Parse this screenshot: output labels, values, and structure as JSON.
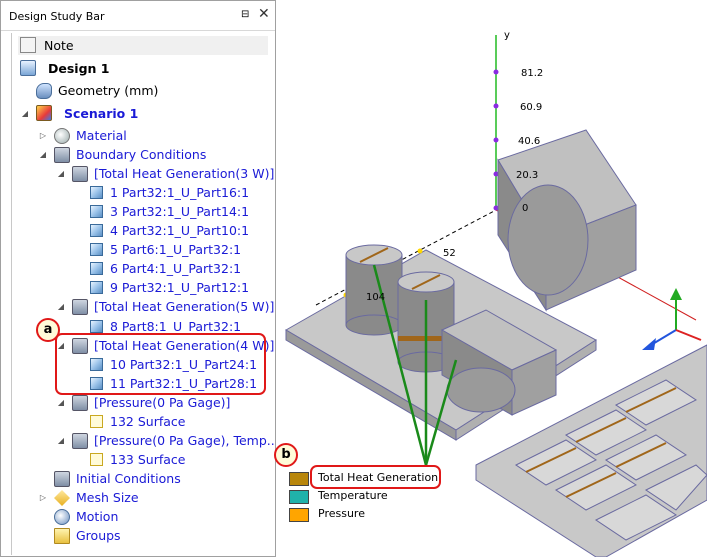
{
  "panel": {
    "title": "Design Study Bar",
    "pin_glyph": "⊟",
    "close_glyph": "✕"
  },
  "tree": {
    "note": "Note",
    "design": "Design 1",
    "geometry": "Geometry (mm)",
    "scenario": "Scenario 1",
    "material": "Material",
    "boundary_conditions": "Boundary Conditions",
    "heat_gen_3w": {
      "label": "[Total Heat Generation(3 W)]",
      "children": [
        "1 Part32:1_U_Part16:1",
        "3 Part32:1_U_Part14:1",
        "4 Part32:1_U_Part10:1",
        "5 Part6:1_U_Part32:1",
        "6 Part4:1_U_Part32:1",
        "9 Part32:1_U_Part12:1"
      ]
    },
    "heat_gen_5w": {
      "label": "[Total Heat Generation(5 W)]",
      "children": [
        "8 Part8:1_U_Part32:1"
      ]
    },
    "heat_gen_4w": {
      "label": "[Total Heat Generation(4 W)]",
      "children": [
        "10 Part32:1_U_Part24:1",
        "11 Part32:1_U_Part28:1"
      ]
    },
    "pressure_1": {
      "label": "[Pressure(0 Pa Gage)]",
      "children": [
        "132 Surface"
      ]
    },
    "pressure_2": {
      "label": "[Pressure(0 Pa Gage), Temp...",
      "children": [
        "133 Surface"
      ]
    },
    "initial_conditions": "Initial Conditions",
    "mesh_size": "Mesh Size",
    "motion": "Motion",
    "groups": "Groups"
  },
  "callouts": {
    "a": "a",
    "b": "b"
  },
  "viewport": {
    "axis_y_label": "y",
    "axis_ticks": [
      "81.2",
      "60.9",
      "40.6",
      "20.3",
      "0"
    ],
    "dim_52": "52",
    "dim_104": "104",
    "legend": [
      {
        "label": "Total Heat Generation",
        "color": "#b8860b"
      },
      {
        "label": "Temperature",
        "color": "#20b2aa"
      },
      {
        "label": "Pressure",
        "color": "#ffa500"
      }
    ]
  },
  "colors": {
    "accent_red": "#e01818",
    "tree_blue": "#1a1ad6",
    "leader_green": "#1a8a1a"
  }
}
